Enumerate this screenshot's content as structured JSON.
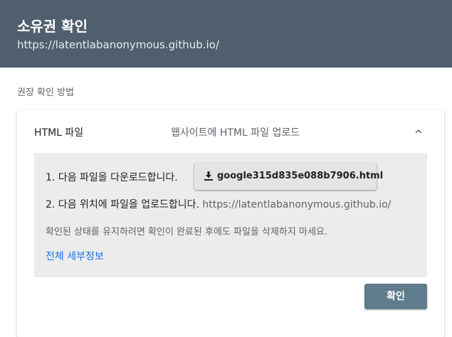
{
  "header": {
    "title": "소유권 확인",
    "subtitle": "https://latentlabanonymous.github.io/"
  },
  "section_label": "권장 확인 방법",
  "method": {
    "name": "HTML 파일",
    "description": "웹사이트에 HTML 파일 업로드",
    "chevron_icon": "chevron-up-icon"
  },
  "panel": {
    "step1_label": "1. 다음 파일을 다운로드합니다.",
    "download_filename": "google315d835e088b7906.html",
    "download_icon": "download-icon",
    "step2_label": "2. 다음 위치에 파일을 업로드합니다.",
    "step2_url": "https://latentlabanonymous.github.io/",
    "note": "확인된 상태를 유지하려면 확인이 완료된 후에도 파일을 삭제하지 마세요.",
    "details_link": "전체 세부정보"
  },
  "confirm_button": "확인",
  "colors": {
    "header_bg": "#4f5f6e",
    "panel_bg": "#ececec",
    "link": "#1a73e8",
    "confirm_bg": "#5f7d8c"
  }
}
